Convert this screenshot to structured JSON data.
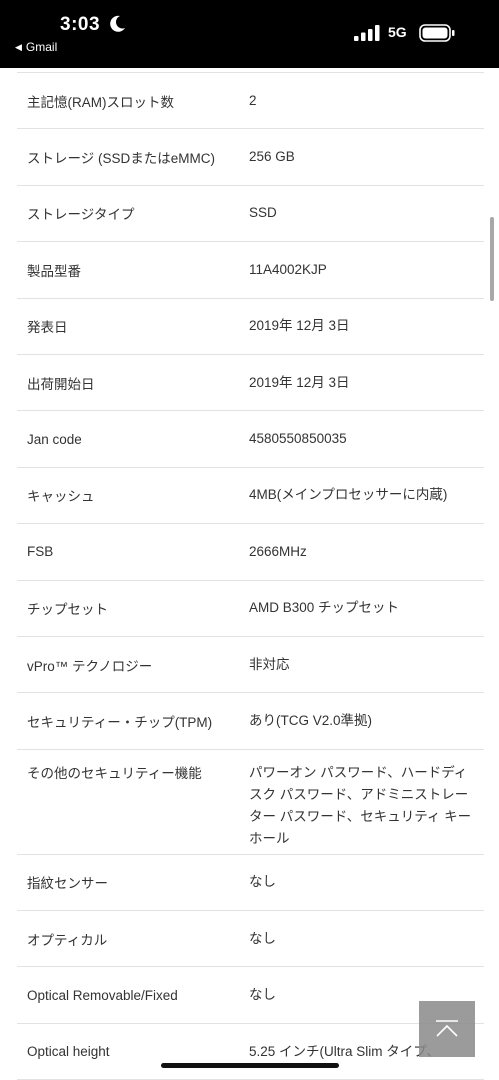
{
  "status_bar": {
    "time": "3:03",
    "back_label": "Gmail",
    "network": "5G"
  },
  "specs": [
    {
      "label": "主記憶(RAM)スロット数",
      "value": "2"
    },
    {
      "label": "ストレージ (SSDまたはeMMC)",
      "value": "256 GB"
    },
    {
      "label": "ストレージタイプ",
      "value": "SSD"
    },
    {
      "label": "製品型番",
      "value": "11A4002KJP"
    },
    {
      "label": "発表日",
      "value": "2019年 12月 3日"
    },
    {
      "label": "出荷開始日",
      "value": "2019年 12月 3日"
    },
    {
      "label": "Jan code",
      "value": "4580550850035"
    },
    {
      "label": "キャッシュ",
      "value": "4MB(メインプロセッサーに内蔵)"
    },
    {
      "label": "FSB",
      "value": "2666MHz"
    },
    {
      "label": "チップセット",
      "value": "AMD B300 チップセット"
    },
    {
      "label": "vPro™ テクノロジー",
      "value": "非対応"
    },
    {
      "label": "セキュリティー・チップ(TPM)",
      "value": "あり(TCG V2.0準拠)"
    },
    {
      "label": "その他のセキュリティー機能",
      "value": "パワーオン パスワード、ハードディスク パスワード、アドミニストレーター パスワード、セキュリティ キーホール"
    },
    {
      "label": "指紋センサー",
      "value": "なし"
    },
    {
      "label": "オプティカル",
      "value": "なし"
    },
    {
      "label": "Optical Removable/Fixed",
      "value": "なし"
    },
    {
      "label": "Optical height",
      "value": "5.25 インチ(Ultra Slim タイプ、"
    }
  ],
  "icons": {
    "moon": "moon-icon",
    "signal": "signal-icon",
    "battery": "battery-icon",
    "back_to_top": "chevron-up-icon"
  }
}
